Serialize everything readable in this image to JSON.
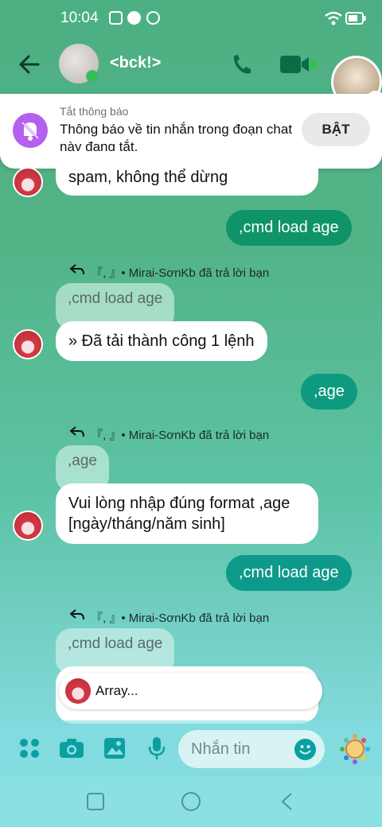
{
  "status_bar": {
    "time": "10:04"
  },
  "header": {
    "title": "<bck!>"
  },
  "notice": {
    "small": "Tắt thông báo",
    "message": "Thông báo về tin nhắn trong đoạn chat này đang tắt.",
    "button": "BẬT"
  },
  "messages": {
    "m1_text": "spam, không thể dừng",
    "out1": ",cmd load age",
    "reply1_label": "『, 』• Mirai-SơnKb đã trả lời bạn",
    "quote1": ",cmd load age",
    "m2_text": "» Đã tải thành công 1 lệnh",
    "out2": ",age",
    "reply2_label": "『, 』• Mirai-SơnKb đã trả lời bạn",
    "quote2": ",age",
    "m3_text": "Vui lòng nhập đúng format ,age [ngày/tháng/năm sinh]",
    "out3": ",cmd load age",
    "reply3_label": "『, 』• Mirai-SơnKb đã trả lời bạn",
    "quote3": ",cmd load age"
  },
  "typing": {
    "text": "Array..."
  },
  "composer": {
    "placeholder": "Nhắn tin"
  },
  "colors": {
    "outgoing": "#0e9468",
    "accent": "#0aa0a2",
    "bell": "#b55ff0"
  },
  "icons": [
    "back-icon",
    "phone-icon",
    "video-icon",
    "info-icon",
    "bell-off-icon",
    "menu-dots-icon",
    "camera-icon",
    "image-icon",
    "mic-icon",
    "emoji-icon",
    "sticker-icon",
    "nav-square-icon",
    "nav-circle-icon",
    "nav-back-icon"
  ]
}
